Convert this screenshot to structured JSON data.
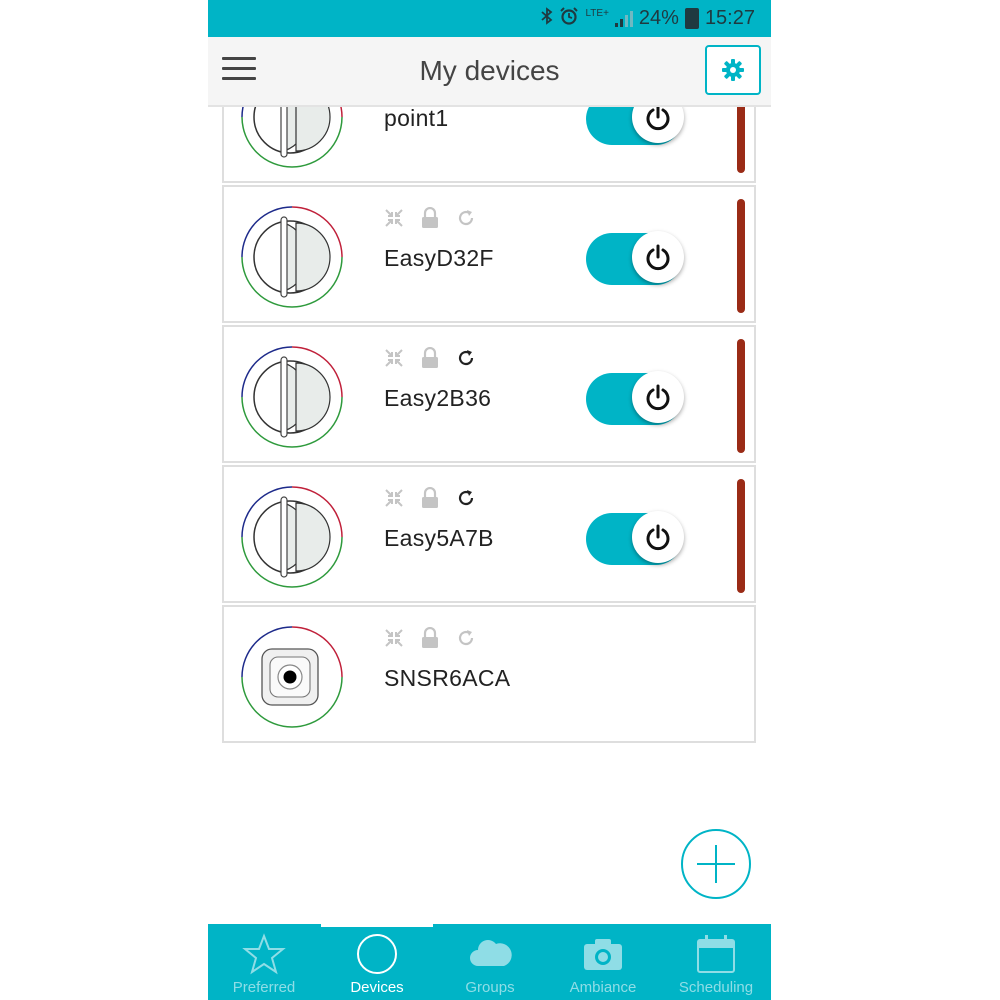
{
  "status_bar": {
    "network": "LTE+",
    "battery": "24%",
    "time": "15:27"
  },
  "header": {
    "title": "My devices"
  },
  "devices": [
    {
      "name": "point1",
      "type": "presence-detector",
      "sync_active": false
    },
    {
      "name": "EasyD32F",
      "type": "presence-detector",
      "sync_active": false
    },
    {
      "name": "Easy2B36",
      "type": "presence-detector",
      "sync_active": true
    },
    {
      "name": "Easy5A7B",
      "type": "presence-detector",
      "sync_active": true
    },
    {
      "name": "SNSR6ACA",
      "type": "sensor",
      "sync_active": false
    }
  ],
  "bottom_nav": {
    "items": [
      {
        "label": "Preferred",
        "icon": "star-icon",
        "active": false
      },
      {
        "label": "Devices",
        "icon": "circle-icon",
        "active": true
      },
      {
        "label": "Groups",
        "icon": "cloud-icon",
        "active": false
      },
      {
        "label": "Ambiance",
        "icon": "camera-icon",
        "active": false
      },
      {
        "label": "Scheduling",
        "icon": "calendar-icon",
        "active": false
      }
    ]
  },
  "colors": {
    "accent": "#00b4c6",
    "state_bar": "#9a2b16",
    "header_bg": "#f5f5f5"
  }
}
